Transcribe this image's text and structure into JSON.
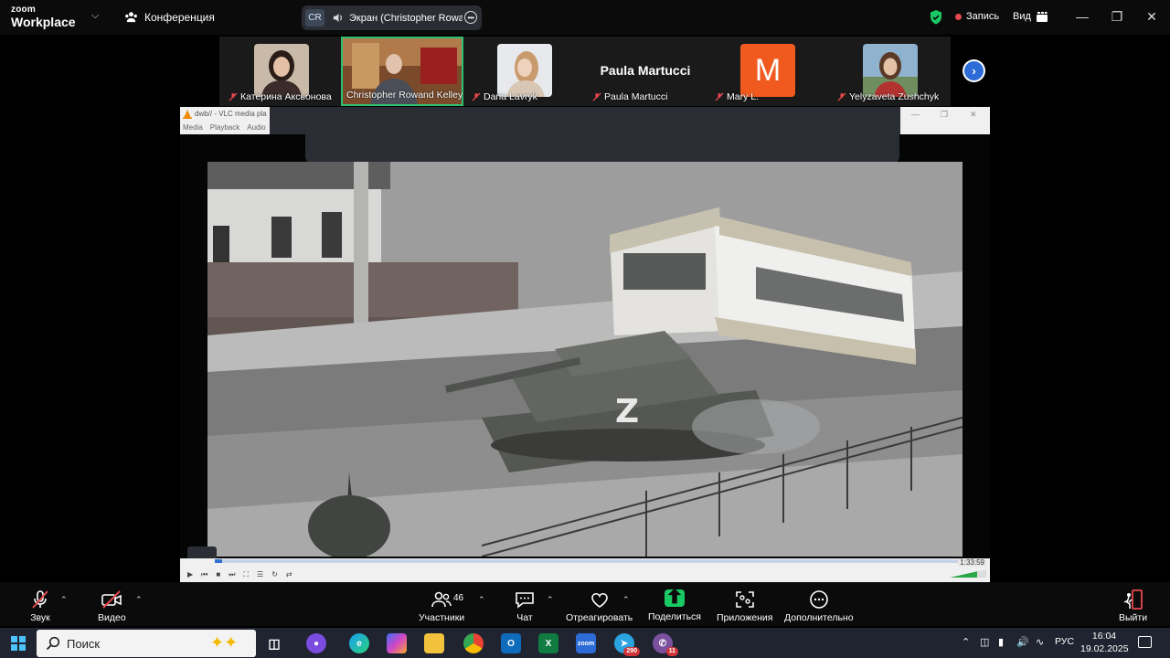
{
  "topbar": {
    "logo_line1": "zoom",
    "logo_line2": "Workplace",
    "conference_label": "Конференция",
    "share_initials": "CR",
    "share_text": "Экран (Christopher Rowand",
    "record_label": "Запись",
    "view_label": "Вид",
    "colors": {
      "record_dot": "#e5484d",
      "shield": "#18c964"
    }
  },
  "participants": [
    {
      "name": "Катерина Аксьонова",
      "muted": true,
      "kind": "photo"
    },
    {
      "name": "Christopher Rowand Kelley",
      "muted": false,
      "kind": "photo",
      "speaking": true
    },
    {
      "name": "Daria Lavryk",
      "muted": true,
      "kind": "photo"
    },
    {
      "name": "Paula Martucci",
      "muted": true,
      "kind": "name-only",
      "display": "Paula Martucci"
    },
    {
      "name": "Mary L.",
      "muted": true,
      "kind": "avatar",
      "initial": "M",
      "color": "#f05a1f"
    },
    {
      "name": "Yelyzaveta Zushchyk",
      "muted": true,
      "kind": "photo"
    }
  ],
  "shared_screen": {
    "vlc_title": "dwb// - VLC media pla",
    "vlc_menu": [
      "Media",
      "Playback",
      "Audio"
    ],
    "video_overlay_letter": "Z",
    "time_display": "1:33:59",
    "progress_fraction": 0.01
  },
  "toolbar": {
    "audio_label": "Звук",
    "video_label": "Видео",
    "participants_label": "Участники",
    "participants_count": "46",
    "chat_label": "Чат",
    "react_label": "Отреагировать",
    "share_label": "Поделиться",
    "apps_label": "Приложения",
    "more_label": "Дополнительно",
    "leave_label": "Выйти",
    "colors": {
      "share_green": "#18c964",
      "muted_red": "#e5484d"
    }
  },
  "taskbar": {
    "search_placeholder": "Поиск",
    "language": "РУС",
    "time": "16:04",
    "date": "19.02.2025",
    "telegram_badge": "290",
    "viber_badge": "11"
  }
}
